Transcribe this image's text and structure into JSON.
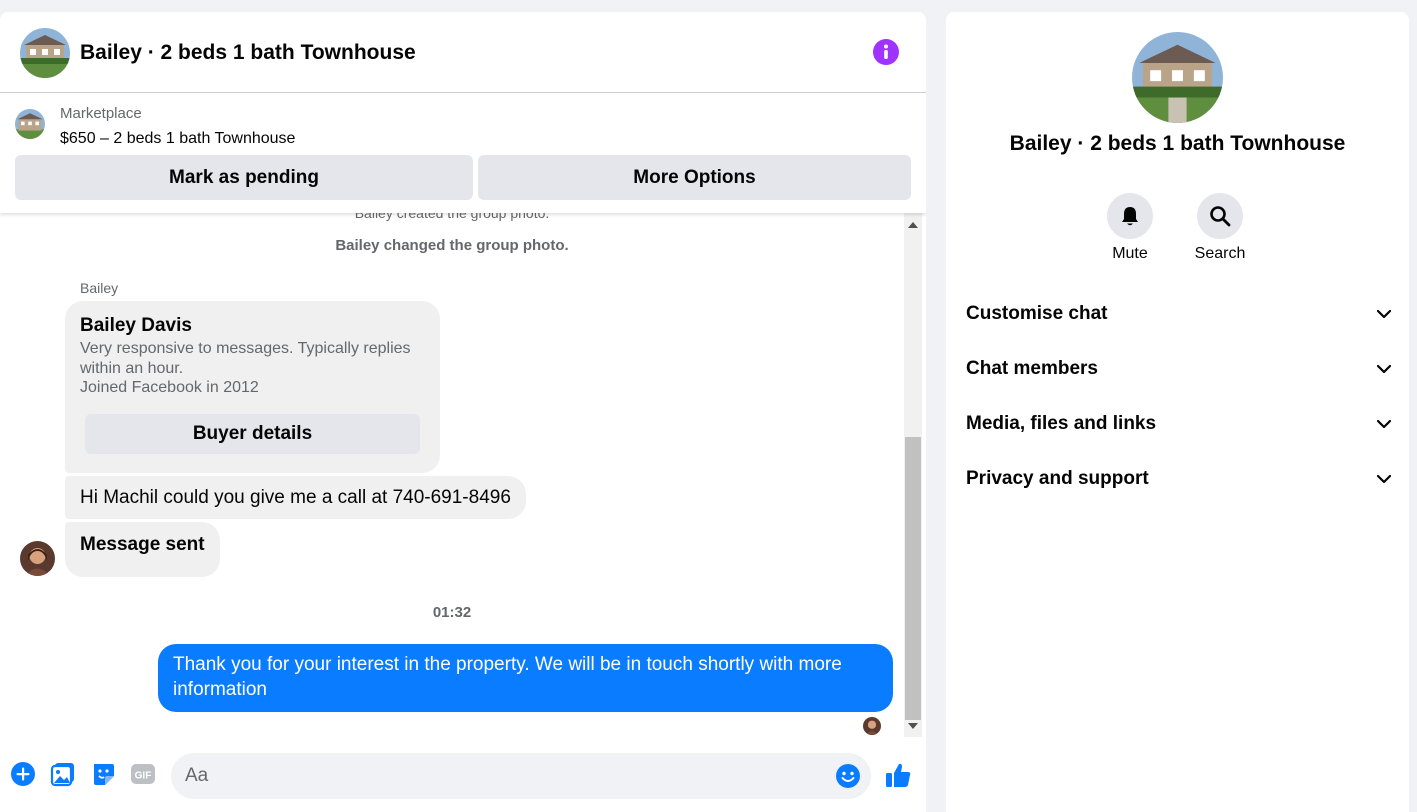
{
  "chat": {
    "title": "Bailey · 2 beds 1 bath Townhouse",
    "marketplace_label": "Marketplace",
    "listing_title": "$650 – 2 beds 1 bath Townhouse",
    "mark_pending_label": "Mark as pending",
    "more_options_label": "More Options"
  },
  "messages": {
    "partial_top": "Bailey created the group photo.",
    "system_message": "Bailey changed the group photo.",
    "sender_name": "Bailey",
    "profile_card": {
      "name": "Bailey Davis",
      "description": "Very responsive to messages. Typically replies within an hour.",
      "joined": "Joined Facebook in 2012",
      "button_label": "Buyer details"
    },
    "incoming_1": "Hi Machil could you give me a call at 740-691-8496",
    "incoming_2": "Message sent",
    "timestamp": "01:32",
    "outgoing_1": "Thank you for your interest in the property. We will be in touch shortly with more information"
  },
  "composer": {
    "placeholder": "Aa",
    "value": ""
  },
  "info_panel": {
    "title": "Bailey · 2 beds 1 bath Townhouse",
    "mute_label": "Mute",
    "search_label": "Search",
    "sections": [
      {
        "label": "Customise chat"
      },
      {
        "label": "Chat members"
      },
      {
        "label": "Media, files and links"
      },
      {
        "label": "Privacy and support"
      }
    ]
  },
  "colors": {
    "accent_blue": "#0a7cff",
    "info_purple": "#a033ff",
    "icon_blue": "#0a7cff"
  },
  "icons": [
    "info-icon",
    "plus-icon",
    "photo-icon",
    "sticker-icon",
    "gif-icon",
    "emoji-icon",
    "like-icon",
    "bell-icon",
    "search-icon",
    "chevron-down-icon"
  ]
}
